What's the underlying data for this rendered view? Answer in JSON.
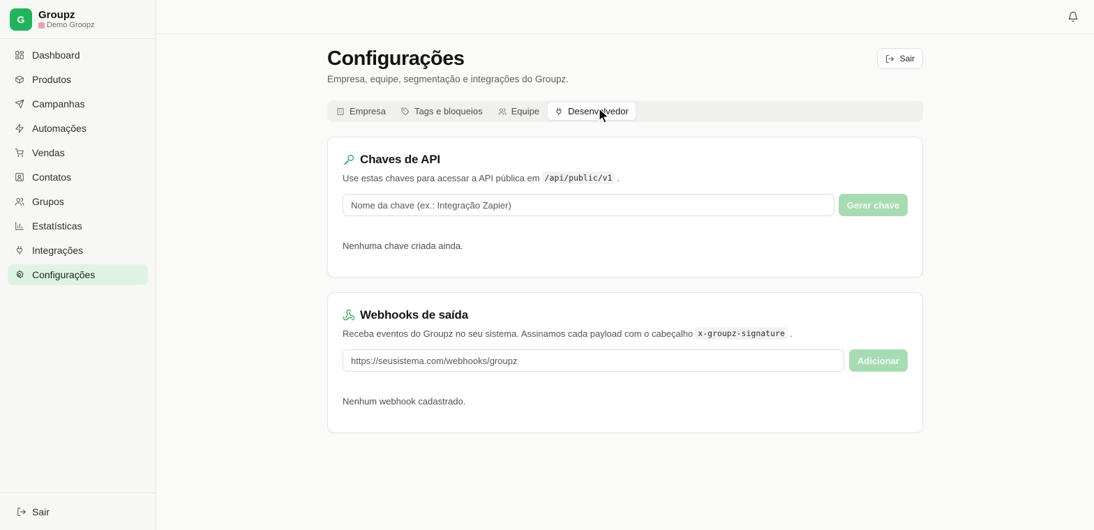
{
  "brand": {
    "logo_letter": "G",
    "name": "Groupz",
    "workspace": "Demo Groopz",
    "accent": "#22b45a"
  },
  "sidebar": {
    "items": [
      {
        "label": "Dashboard",
        "icon": "dashboard-icon"
      },
      {
        "label": "Produtos",
        "icon": "package-icon"
      },
      {
        "label": "Campanhas",
        "icon": "send-icon"
      },
      {
        "label": "Automações",
        "icon": "zap-icon"
      },
      {
        "label": "Vendas",
        "icon": "cart-icon"
      },
      {
        "label": "Contatos",
        "icon": "contact-icon"
      },
      {
        "label": "Grupos",
        "icon": "users-icon"
      },
      {
        "label": "Estatísticas",
        "icon": "bar-chart-icon"
      },
      {
        "label": "Integrações",
        "icon": "plug-icon"
      },
      {
        "label": "Configurações",
        "icon": "gear-icon",
        "active": true
      }
    ],
    "logout_label": "Sair"
  },
  "header": {
    "title": "Configurações",
    "subtitle": "Empresa, equipe, segmentação e integrações do Groupz.",
    "logout_label": "Sair"
  },
  "tabs": [
    {
      "label": "Empresa",
      "icon": "building-icon"
    },
    {
      "label": "Tags e bloqueios",
      "icon": "tag-icon"
    },
    {
      "label": "Equipe",
      "icon": "users-icon"
    },
    {
      "label": "Desenvolvedor",
      "icon": "plug-icon",
      "active": true
    }
  ],
  "api_keys": {
    "title": "Chaves de API",
    "desc_prefix": "Use estas chaves para acessar a API pública em",
    "desc_code": "/api/public/v1",
    "desc_suffix": ".",
    "input_placeholder": "Nome da chave (ex.: Integração Zapier)",
    "button_label": "Gerar chave",
    "empty_text": "Nenhuma chave criada ainda."
  },
  "webhooks": {
    "title": "Webhooks de saída",
    "desc_prefix": "Receba eventos do Groupz no seu sistema. Assinamos cada payload com o cabeçalho",
    "desc_code": "x-groupz-signature",
    "desc_suffix": ".",
    "input_placeholder": "https://seusistema.com/webhooks/groupz",
    "button_label": "Adicionar",
    "empty_text": "Nenhum webhook cadastrado."
  }
}
